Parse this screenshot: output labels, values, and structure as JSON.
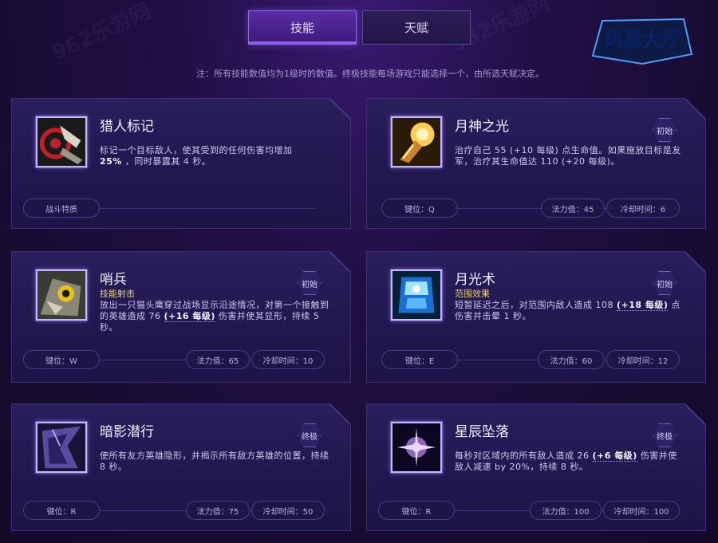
{
  "tabs": [
    {
      "label": "技能",
      "active": true
    },
    {
      "label": "天赋",
      "active": false
    }
  ],
  "logo_text": "风暴大厅",
  "note": "注：所有技能数值均为1级时的数值。终极技能每场游戏只能选择一个，由所选天赋决定。",
  "colors": {
    "accent": "#8d5cf0",
    "type_label": "#e7d27a",
    "card_bg": "#2a1e5c"
  },
  "watermark": "962乐游网",
  "skills": [
    {
      "name": "猎人标记",
      "type": "",
      "badge": "",
      "desc_pre": "标记一个目标敌人，使其受到的任何伤害均增加",
      "desc_value": "25%",
      "desc_post": "，同时暴露其 4 秒。",
      "key": "战斗特质",
      "mana": "",
      "cooldown": "",
      "icon": "hunter-mark-icon"
    },
    {
      "name": "月神之光",
      "type": "",
      "badge": "初始",
      "desc_pre": "治疗自己 55 (+10 每级) 点生命值。如果施放目标是友军，治疗其生命值达 110 (+20 每级)。",
      "desc_value": "",
      "desc_post": "",
      "key": "键位：Q",
      "mana": "法力值：45",
      "cooldown": "冷却时间：6",
      "icon": "moonlight-glow-icon"
    },
    {
      "name": "哨兵",
      "type": "技能射击",
      "badge": "初始",
      "desc_pre": "放出一只猫头鹰穿过战场显示沿途情况，对第一个接触到的英雄造成 76",
      "desc_value": "(+16 每级)",
      "desc_post": "伤害并使其显形，持续 5 秒。",
      "key": "键位：W",
      "mana": "法力值：65",
      "cooldown": "冷却时间：10",
      "icon": "owl-sentinel-icon"
    },
    {
      "name": "月光术",
      "type": "范围效果",
      "badge": "初始",
      "desc_pre": "短暂延迟之后，对范围内敌人造成 108",
      "desc_value": "(+18 每级)",
      "desc_post": "点伤害并击晕 1 秒。",
      "key": "键位：E",
      "mana": "法力值：60",
      "cooldown": "冷却时间：12",
      "icon": "moonfire-icon"
    },
    {
      "name": "暗影潜行",
      "type": "",
      "badge": "终极",
      "desc_pre": "使所有友方英雄隐形，并揭示所有敌方英雄的位置，持续 8 秒。",
      "desc_value": "",
      "desc_post": "",
      "key": "键位：R",
      "mana": "法力值：75",
      "cooldown": "冷却时间：50",
      "icon": "shadowstalk-icon"
    },
    {
      "name": "星辰坠落",
      "type": "",
      "badge": "终极",
      "desc_pre": "每秒对区域内的所有敌人造成 26",
      "desc_value": "(+6 每级)",
      "desc_post": "伤害并使敌人减速 by 20%，持续 8 秒。",
      "key": "键位：R",
      "mana": "法力值：100",
      "cooldown": "冷却时间：100",
      "icon": "starfall-icon"
    }
  ]
}
